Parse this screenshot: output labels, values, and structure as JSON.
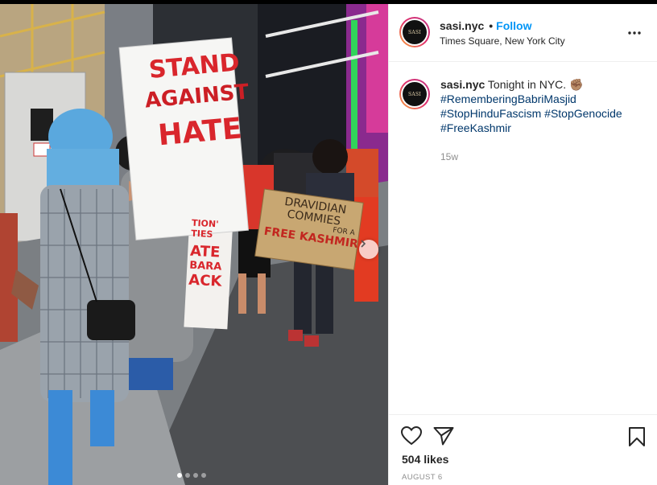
{
  "post": {
    "author": {
      "username": "sasi.nyc",
      "avatar_text": "SASI",
      "follow_label": "Follow",
      "separator": "•",
      "location": "Times Square, New York City"
    },
    "caption": {
      "username": "sasi.nyc",
      "text": "Tonight in NYC.",
      "emoji": "✊🏽",
      "hashtags": [
        "#RememberingBabriMasjid",
        "#StopHinduFascism",
        "#StopGenocide",
        "#FreeKashmir"
      ],
      "time_ago": "15w"
    },
    "likes": "504 likes",
    "date": "AUGUST 6",
    "carousel": {
      "count": 4,
      "active_index": 0
    },
    "photo": {
      "sign_main": [
        "STAND",
        "AGAINST",
        "HATE"
      ],
      "sign_brown": [
        "DRAVIDIAN",
        "COMMIES",
        "FOR A",
        "FREE KASHMIR"
      ],
      "sign_small": [
        "TION'",
        "TIES",
        "ATE",
        "BARA",
        "ACK"
      ]
    },
    "icons": {
      "more": "more-options-icon",
      "like": "heart-icon",
      "share": "paper-plane-icon",
      "save": "bookmark-icon",
      "next": "chevron-right-icon"
    },
    "colors": {
      "follow": "#0095f6",
      "hashtag": "#00376b",
      "muted": "#8e8e8e",
      "sign_red": "#d9262c"
    }
  }
}
